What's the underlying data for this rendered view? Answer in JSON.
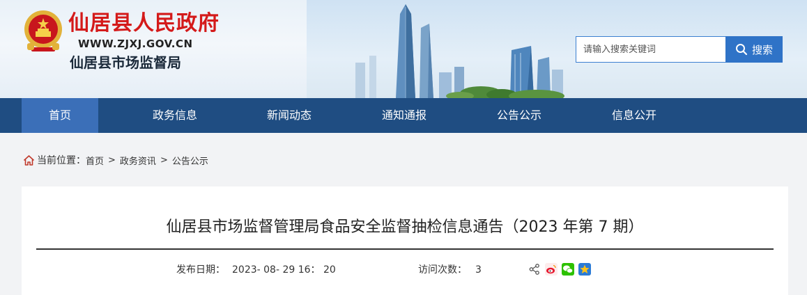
{
  "header": {
    "site_name": "仙居县人民政府",
    "site_url": "WWW.ZJXJ.GOV.CN",
    "dept_name": "仙居县市场监督局",
    "emblem_icon": "national-emblem-icon"
  },
  "search": {
    "placeholder": "请输入搜索关键词",
    "button_label": "搜索"
  },
  "nav": {
    "items": [
      {
        "label": "首页"
      },
      {
        "label": "政务信息"
      },
      {
        "label": "新闻动态"
      },
      {
        "label": "通知通报"
      },
      {
        "label": "公告公示"
      },
      {
        "label": "信息公开"
      }
    ]
  },
  "breadcrumb": {
    "label": "当前位置：",
    "crumbs": [
      "首页",
      "政务资讯",
      "公告公示"
    ],
    "separator": ">"
  },
  "article": {
    "title": "仙居县市场监督管理局食品安全监督抽检信息通告（2023 年第 7 期）",
    "publish_label": "发布日期：",
    "publish_date": "2023- 08- 29 16： 20",
    "visits_label": "访问次数：",
    "visits": "3"
  },
  "colors": {
    "nav_bg": "#1f4d82",
    "nav_active": "#3b6fb8",
    "brand_red": "#d41a1a",
    "search_btn": "#2f73c7"
  }
}
